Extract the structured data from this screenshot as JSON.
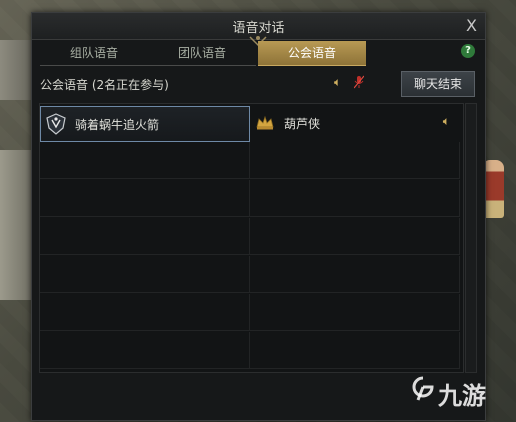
{
  "dialog": {
    "title": "语音对话",
    "close_glyph": "X",
    "help_glyph": "?"
  },
  "tabs": [
    {
      "label": "组队语音",
      "active": false
    },
    {
      "label": "团队语音",
      "active": false
    },
    {
      "label": "公会语音",
      "active": true
    }
  ],
  "status": {
    "label": "公会语音 (2名正在参与)",
    "end_button": "聊天结束"
  },
  "members": [
    {
      "name": "骑着蜗牛追火箭",
      "icon": "guild-crest-icon",
      "selected": true,
      "speaker": false
    },
    {
      "name": "葫芦侠",
      "icon": "crown-icon",
      "selected": false,
      "speaker": true
    }
  ],
  "colors": {
    "accent_gold": "#b89a54",
    "selection_border": "#6e89a6",
    "help_green": "#2f7a3a"
  },
  "watermark": {
    "text": "九游"
  }
}
